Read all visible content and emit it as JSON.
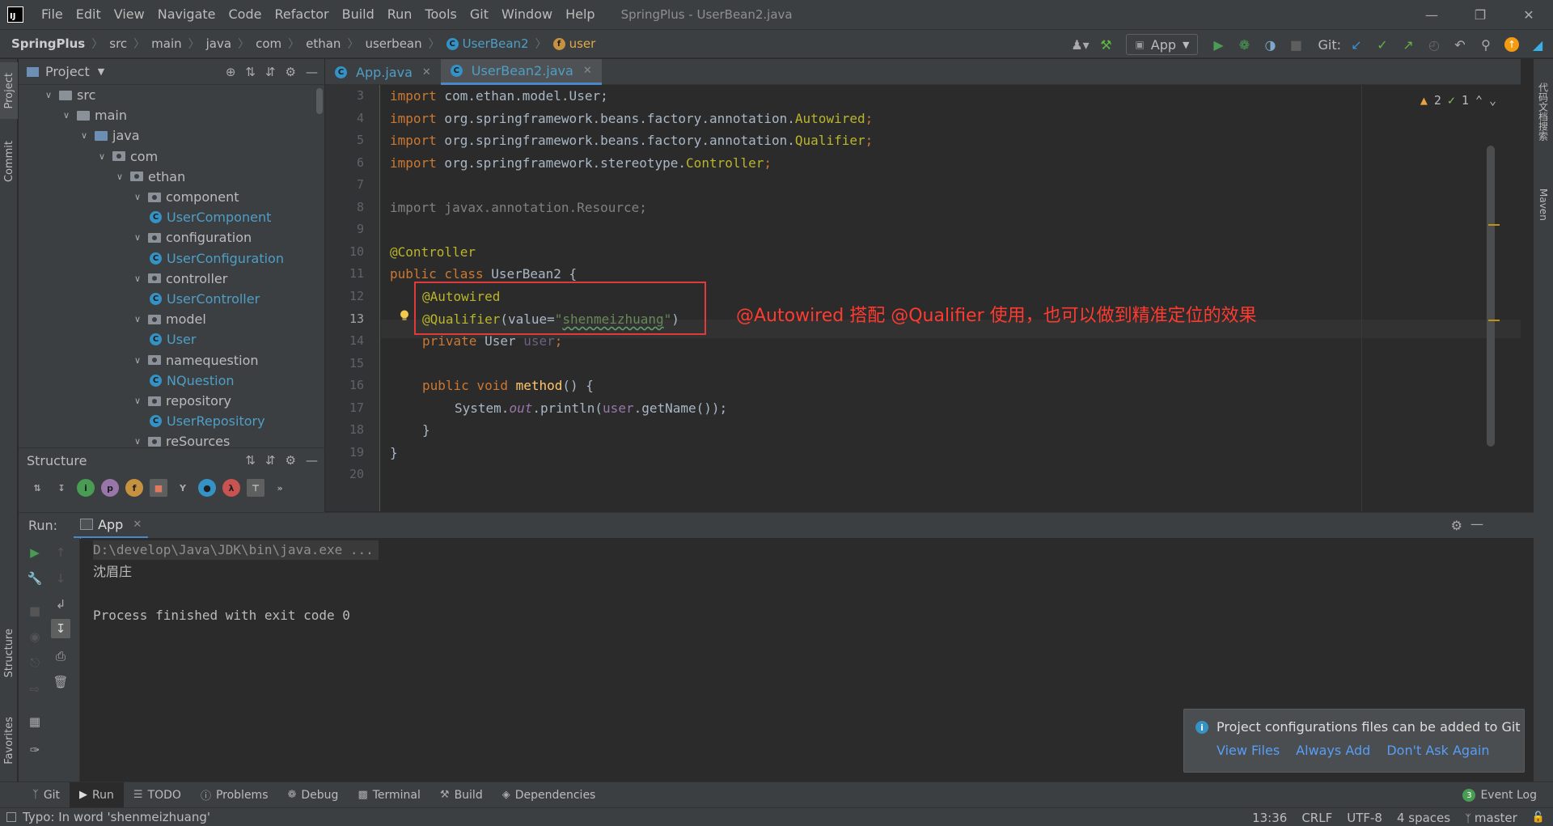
{
  "menubar": {
    "items": [
      "File",
      "Edit",
      "View",
      "Navigate",
      "Code",
      "Refactor",
      "Build",
      "Run",
      "Tools",
      "Git",
      "Window",
      "Help"
    ],
    "title": "SpringPlus - UserBean2.java"
  },
  "navbar": {
    "crumbs": [
      "SpringPlus",
      "src",
      "main",
      "java",
      "com",
      "ethan",
      "userbean"
    ],
    "class_crumb": "UserBean2",
    "field_crumb": "user",
    "run_config": "App",
    "git_label": "Git:"
  },
  "left_strip": {
    "project": "Project",
    "commit": "Commit",
    "structure": "Structure",
    "favorites": "Favorites"
  },
  "right_strip": {
    "plugin": "代码文档搜索",
    "maven": "Maven"
  },
  "project_panel": {
    "title": "Project",
    "tree": [
      {
        "label": "src",
        "depth": 1,
        "kind": "folder"
      },
      {
        "label": "main",
        "depth": 2,
        "kind": "folder"
      },
      {
        "label": "java",
        "depth": 3,
        "kind": "source"
      },
      {
        "label": "com",
        "depth": 4,
        "kind": "package"
      },
      {
        "label": "ethan",
        "depth": 5,
        "kind": "package"
      },
      {
        "label": "component",
        "depth": 6,
        "kind": "package"
      },
      {
        "label": "UserComponent",
        "depth": 7,
        "kind": "class"
      },
      {
        "label": "configuration",
        "depth": 6,
        "kind": "package"
      },
      {
        "label": "UserConfiguration",
        "depth": 7,
        "kind": "class"
      },
      {
        "label": "controller",
        "depth": 6,
        "kind": "package"
      },
      {
        "label": "UserController",
        "depth": 7,
        "kind": "class"
      },
      {
        "label": "model",
        "depth": 6,
        "kind": "package"
      },
      {
        "label": "User",
        "depth": 7,
        "kind": "class"
      },
      {
        "label": "namequestion",
        "depth": 6,
        "kind": "package"
      },
      {
        "label": "NQuestion",
        "depth": 7,
        "kind": "class"
      },
      {
        "label": "repository",
        "depth": 6,
        "kind": "package"
      },
      {
        "label": "UserRepository",
        "depth": 7,
        "kind": "class"
      },
      {
        "label": "reSources",
        "depth": 6,
        "kind": "package"
      }
    ]
  },
  "structure_panel": {
    "title": "Structure"
  },
  "editor": {
    "tabs": [
      {
        "label": "App.java",
        "active": false
      },
      {
        "label": "UserBean2.java",
        "active": true
      }
    ],
    "line_numbers": [
      "3",
      "4",
      "5",
      "6",
      "7",
      "8",
      "9",
      "10",
      "11",
      "12",
      "13",
      "14",
      "15",
      "16",
      "17",
      "18",
      "19",
      "20"
    ],
    "current_line": "13",
    "inspections": {
      "warnings": "2",
      "weak_warnings": "1"
    },
    "code": {
      "l3_kw": "import",
      "l3_rest": " com.ethan.model.User;",
      "l4_kw": "import",
      "l4_a": " org.springframework.beans.factory.annotation.",
      "l4_b": "Autowired",
      "l4_c": ";",
      "l5_kw": "import",
      "l5_a": " org.springframework.beans.factory.annotation.",
      "l5_b": "Qualifier",
      "l5_c": ";",
      "l6_kw": "import",
      "l6_a": " org.springframework.stereotype.",
      "l6_b": "Controller",
      "l6_c": ";",
      "l8": "import javax.annotation.Resource;",
      "l10": "@Controller",
      "l11_kw": "public class",
      "l11_rest": " UserBean2 {",
      "l12": "@Autowired",
      "l13_ann": "@Qualifier",
      "l13_a": "(value=",
      "l13_q1": "\"",
      "l13_str": "shenmeizhuang",
      "l13_q2": "\"",
      "l13_b": ")",
      "l14_kw": "private",
      "l14_type": " User ",
      "l14_fld": "user",
      "l14_end": ";",
      "l16_kw": "public void",
      "l16_fn": " method",
      "l16_rest": "() {",
      "l17_a": "System.",
      "l17_out": "out",
      "l17_b": ".println(",
      "l17_fld": "user",
      "l17_c": ".getName());",
      "l18": "}",
      "l19": "}"
    },
    "annotation_note": "@Autowired 搭配 @Qualifier 使用，也可以做到精准定位的效果"
  },
  "run_panel": {
    "label": "Run:",
    "tab": "App",
    "console": [
      "D:\\develop\\Java\\JDK\\bin\\java.exe ...",
      "沈眉庄",
      "",
      "Process finished with exit code 0"
    ]
  },
  "notification": {
    "message": "Project configurations files can be added to Git",
    "links": [
      "View Files",
      "Always Add",
      "Don't Ask Again"
    ]
  },
  "bottom_toolbar": {
    "items": [
      "Git",
      "Run",
      "TODO",
      "Problems",
      "Debug",
      "Terminal",
      "Build",
      "Dependencies"
    ],
    "event_log": "Event Log",
    "event_count": "3"
  },
  "statusbar": {
    "message": "Typo: In word 'shenmeizhuang'",
    "position": "13:36",
    "line_sep": "CRLF",
    "encoding": "UTF-8",
    "indent": "4 spaces",
    "branch": "master"
  }
}
